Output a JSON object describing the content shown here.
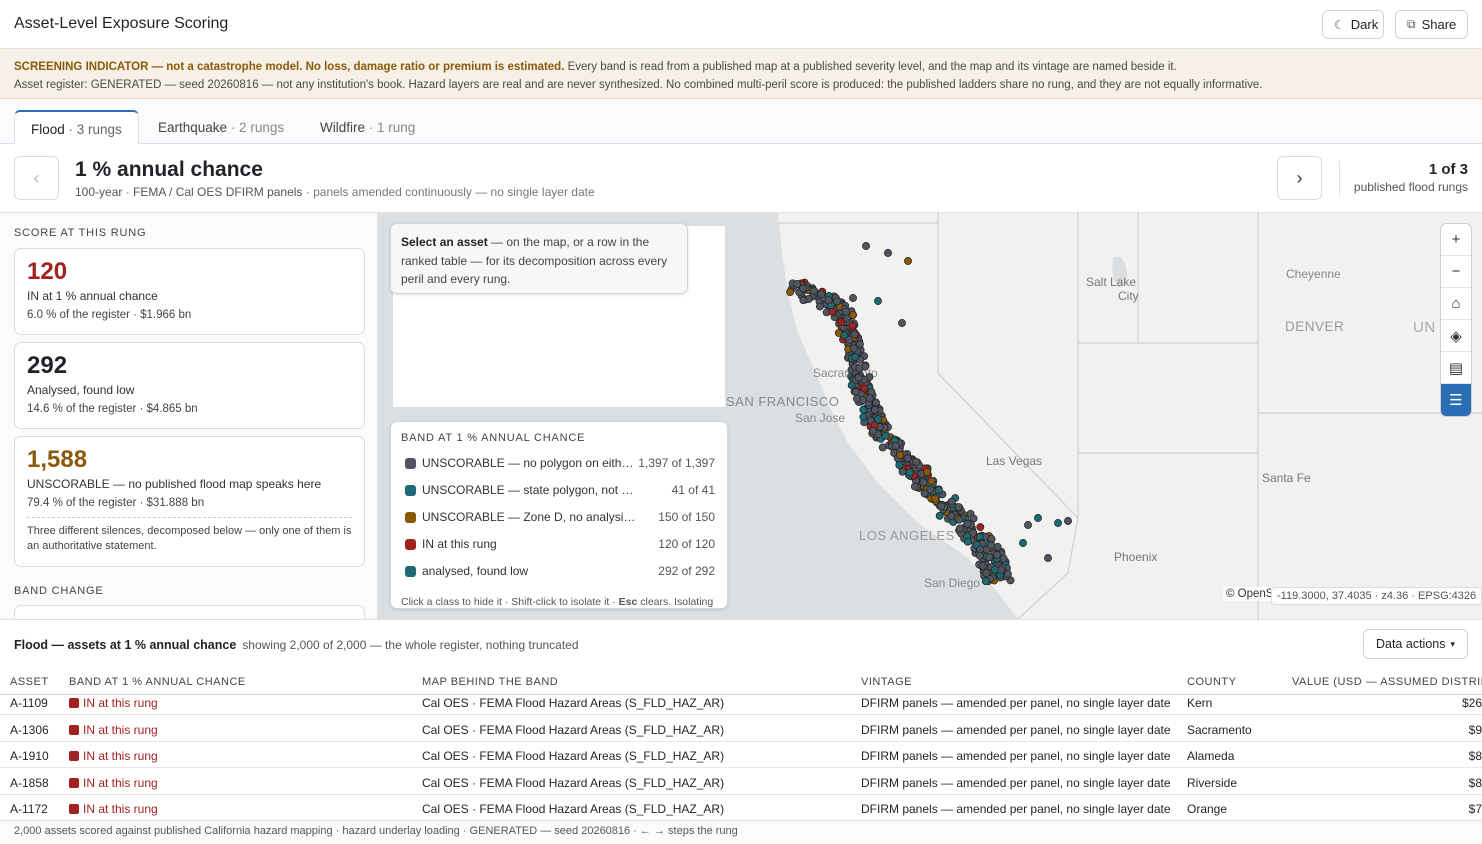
{
  "app": {
    "title": "Asset-Level Exposure Scoring"
  },
  "header": {
    "dark_label": "Dark",
    "dark_icon": "moon-icon",
    "share_label": "Share",
    "share_icon": "share-icon"
  },
  "disclaimer": {
    "strong": "SCREENING INDICATOR — not a catastrophe model. No loss, damage ratio or premium is estimated.",
    "rest": " Every band is read from a published map at a published severity level, and the map and its vintage are named beside it.",
    "line2": "Asset register: GENERATED — seed 20260816 — not any institution's book. Hazard layers are real and are never synthesized. No combined multi-peril score is produced: the published ladders share no rung, and they are not equally informative."
  },
  "tabs": [
    {
      "label": "Flood",
      "rungs": " · 3 rungs"
    },
    {
      "label": "Earthquake",
      "rungs": " · 2 rungs"
    },
    {
      "label": "Wildfire",
      "rungs": " · 1 rung"
    }
  ],
  "rung": {
    "prev": "‹",
    "next": "›",
    "title": "1 % annual chance",
    "sub_a": "100-year",
    "sub_b": "FEMA / Cal OES DFIRM panels",
    "sub_c": "panels amended continuously — no single layer date",
    "sep": " · ",
    "count": "1 of 3",
    "count_label": "published flood rungs"
  },
  "left": {
    "score_label": "SCORE AT THIS RUNG",
    "cards": [
      {
        "big": "120",
        "label": "IN at 1 % annual chance",
        "meta": "6.0 % of the register · $1.966 bn"
      },
      {
        "big": "292",
        "label": "Analysed, found low",
        "meta": "14.6 % of the register · $4.865 bn"
      },
      {
        "big": "1,588",
        "label": "UNSCORABLE — no published flood map speaks here",
        "meta": "79.4 % of the register · $31.888 bn",
        "note": "Three different silences, decomposed below — only one of them is an authoritative statement."
      }
    ],
    "band_change_label": "BAND CHANGE"
  },
  "map": {
    "tip_bold": "Select an asset",
    "tip_rest": " — on the map, or a row in the ranked table — for its decomposition across every peril and every rung.",
    "legend_title": "BAND AT 1 % ANNUAL CHANCE",
    "legend": [
      {
        "label": "UNSCORABLE — no polygon on either layer",
        "count": "1,397 of 1,397",
        "color": "#4f5661"
      },
      {
        "label": "UNSCORABLE — state polygon, not classifiable",
        "count": "41 of 41",
        "color": "#1e6a73"
      },
      {
        "label": "UNSCORABLE — Zone D, no analysis conducted",
        "count": "150 of 150",
        "color": "#8a5a0a"
      },
      {
        "label": "IN at this rung",
        "count": "120 of 120",
        "color": "#a1221f"
      },
      {
        "label": "analysed, found low",
        "count": "292 of 292",
        "color": "#1e6a73"
      }
    ],
    "legend_hint_a": "Click a class to hide it · Shift-click to isolate it · ",
    "legend_hint_b": "Esc",
    "legend_hint_c": " clears. Isolating",
    "cities": [
      {
        "name": "Salt Lake",
        "name2": "City"
      },
      {
        "name": "Cheyenne"
      },
      {
        "name": "DENVER"
      },
      {
        "name": "UN"
      },
      {
        "name": "Sacramento"
      },
      {
        "name": "SAN FRANCISCO"
      },
      {
        "name": "San Jose"
      },
      {
        "name": "Las Vegas"
      },
      {
        "name": "Santa Fe"
      },
      {
        "name": "LOS ANGELES"
      },
      {
        "name": "Phoenix"
      },
      {
        "name": "San Diego"
      }
    ],
    "controls": [
      {
        "icon": "zoom-in-icon",
        "glyph": "+"
      },
      {
        "icon": "zoom-out-icon",
        "glyph": "−"
      },
      {
        "icon": "home-icon",
        "glyph": "⌂"
      },
      {
        "icon": "layers-icon",
        "glyph": "◈"
      },
      {
        "icon": "basemap-icon",
        "glyph": "▤"
      },
      {
        "icon": "list-icon",
        "glyph": "☰"
      }
    ],
    "attribution": "© OpenStreetMap",
    "coords": "-119.3000, 37.4035 · z4.36 · EPSG:4326"
  },
  "table": {
    "title": "Flood — assets at 1 % annual chance",
    "subtitle": "showing 2,000 of 2,000 — the whole register, nothing truncated",
    "data_actions": "Data actions",
    "columns": [
      "ASSET",
      "BAND AT 1 % ANNUAL CHANCE",
      "MAP BEHIND THE BAND",
      "VINTAGE",
      "COUNTY",
      "VALUE (USD — ASSUMED DISTRIBUTION)"
    ],
    "rows": [
      {
        "asset": "A-1109",
        "band": "IN at this rung",
        "map": "Cal OES · FEMA Flood Hazard Areas (S_FLD_HAZ_AR)",
        "vintage": "DFIRM panels — amended per panel, no single layer date",
        "county": "Kern",
        "value": "$26"
      },
      {
        "asset": "A-1306",
        "band": "IN at this rung",
        "map": "Cal OES · FEMA Flood Hazard Areas (S_FLD_HAZ_AR)",
        "vintage": "DFIRM panels — amended per panel, no single layer date",
        "county": "Sacramento",
        "value": "$9"
      },
      {
        "asset": "A-1910",
        "band": "IN at this rung",
        "map": "Cal OES · FEMA Flood Hazard Areas (S_FLD_HAZ_AR)",
        "vintage": "DFIRM panels — amended per panel, no single layer date",
        "county": "Alameda",
        "value": "$8"
      },
      {
        "asset": "A-1858",
        "band": "IN at this rung",
        "map": "Cal OES · FEMA Flood Hazard Areas (S_FLD_HAZ_AR)",
        "vintage": "DFIRM panels — amended per panel, no single layer date",
        "county": "Riverside",
        "value": "$8"
      },
      {
        "asset": "A-1172",
        "band": "IN at this rung",
        "map": "Cal OES · FEMA Flood Hazard Areas (S_FLD_HAZ_AR)",
        "vintage": "DFIRM panels — amended per panel, no single layer date",
        "county": "Orange",
        "value": "$7"
      }
    ]
  },
  "footer": "2,000 assets scored against published California hazard mapping · hazard underlay loading · GENERATED — seed 20260816 · ← → steps the rung"
}
